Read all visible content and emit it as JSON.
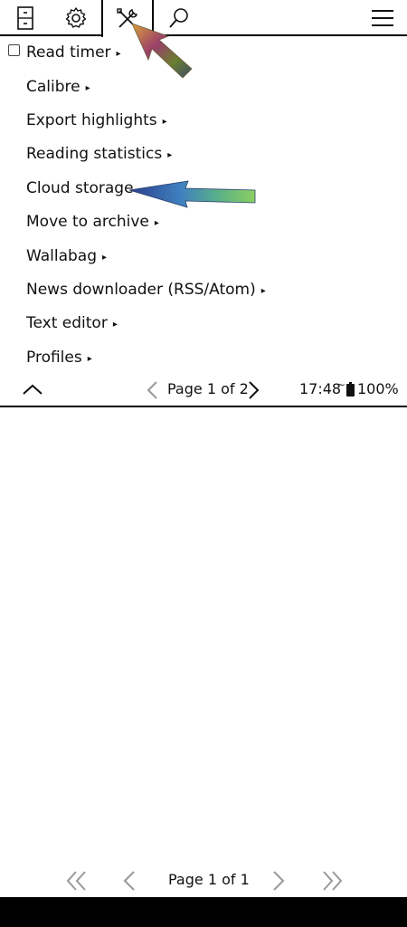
{
  "tabs": [
    {
      "icon": "file-cabinet-icon"
    },
    {
      "icon": "gear-icon"
    },
    {
      "icon": "tools-icon",
      "active": true
    },
    {
      "icon": "search-icon"
    },
    {
      "icon": "hamburger-menu-icon"
    }
  ],
  "menu": {
    "items": [
      {
        "label": "Read timer",
        "has_checkbox": true,
        "checked": false,
        "has_submenu": true
      },
      {
        "label": "Calibre",
        "has_submenu": true
      },
      {
        "label": "Export highlights",
        "has_submenu": true
      },
      {
        "label": "Reading statistics",
        "has_submenu": true
      },
      {
        "label": "Cloud storage",
        "has_submenu": false
      },
      {
        "label": "Move to archive",
        "has_submenu": true
      },
      {
        "label": "Wallabag",
        "has_submenu": true
      },
      {
        "label": "News downloader (RSS/Atom)",
        "has_submenu": true
      },
      {
        "label": "Text editor",
        "has_submenu": true
      },
      {
        "label": "Profiles",
        "has_submenu": true
      }
    ],
    "submenu_arrow": "▸"
  },
  "menu_footer": {
    "page_label": "Page 1 of 2",
    "time": "17:48",
    "wifi_symbol": "~",
    "battery": "100%"
  },
  "bottom_nav": {
    "page_label": "Page 1 of 1"
  },
  "colors": {
    "annotation_arrow_1": "#8a6a3a",
    "annotation_arrow_2": "#3a63b0"
  }
}
